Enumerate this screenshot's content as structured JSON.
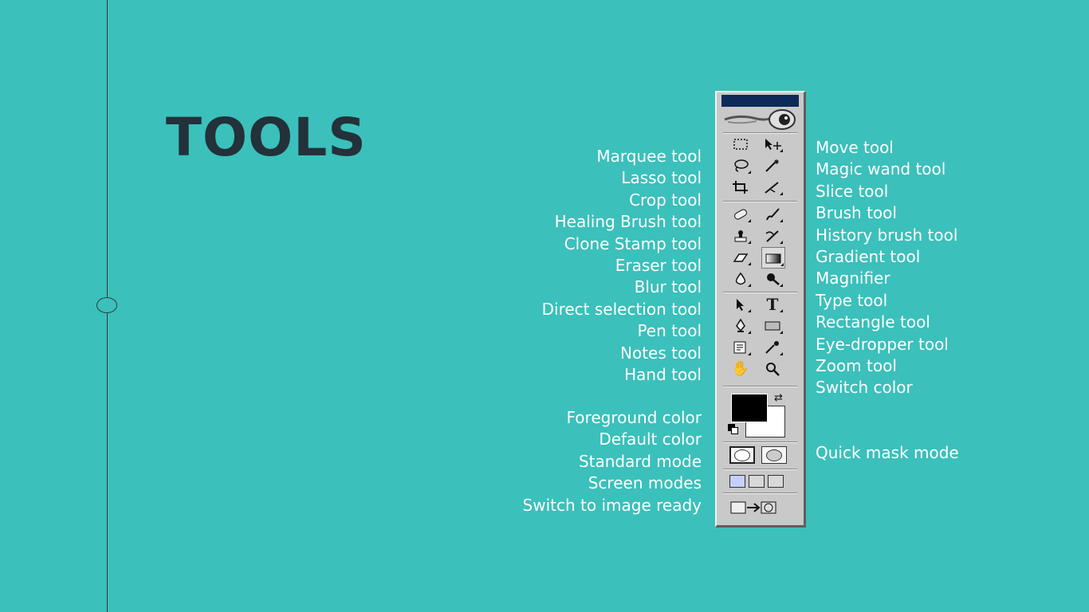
{
  "slide": {
    "title": "TOOLS"
  },
  "labels_left": [
    "Marquee tool",
    "Lasso tool",
    "Crop tool",
    "Healing Brush tool",
    "Clone Stamp tool",
    "Eraser tool",
    "Blur tool",
    "Direct selection tool",
    "Pen tool",
    "Notes tool",
    "Hand tool"
  ],
  "labels_left_bottom": [
    "Foreground color",
    "Default color",
    "Standard mode",
    "Screen modes",
    "Switch to image ready"
  ],
  "labels_right": [
    "Move tool",
    "Magic wand tool",
    "Slice tool",
    "Brush tool",
    "History brush tool",
    "Gradient tool",
    "Magnifier",
    "Type tool",
    "Rectangle tool",
    "Eye-dropper tool",
    "Zoom tool",
    "Switch color"
  ],
  "labels_right_bottom": [
    "Quick mask mode"
  ],
  "toolbox": {
    "colors": {
      "background": "#c9c9c9",
      "titlebar": "#0d2a5a",
      "foreground_swatch": "#000000",
      "background_swatch": "#ffffff"
    },
    "tool_icons": [
      [
        "marquee-icon",
        "move-icon"
      ],
      [
        "lasso-icon",
        "magic-wand-icon"
      ],
      [
        "crop-icon",
        "slice-icon"
      ],
      [
        "healing-brush-icon",
        "brush-icon"
      ],
      [
        "clone-stamp-icon",
        "history-brush-icon"
      ],
      [
        "eraser-icon",
        "gradient-icon"
      ],
      [
        "blur-icon",
        "dodge-icon"
      ],
      [
        "direct-selection-icon",
        "type-icon"
      ],
      [
        "pen-icon",
        "rectangle-icon"
      ],
      [
        "notes-icon",
        "eyedropper-icon"
      ],
      [
        "hand-icon",
        "zoom-icon"
      ]
    ]
  },
  "theme": {
    "background": "#3bc0bb",
    "title_color": "#23313a",
    "label_color": "#ffffff"
  }
}
